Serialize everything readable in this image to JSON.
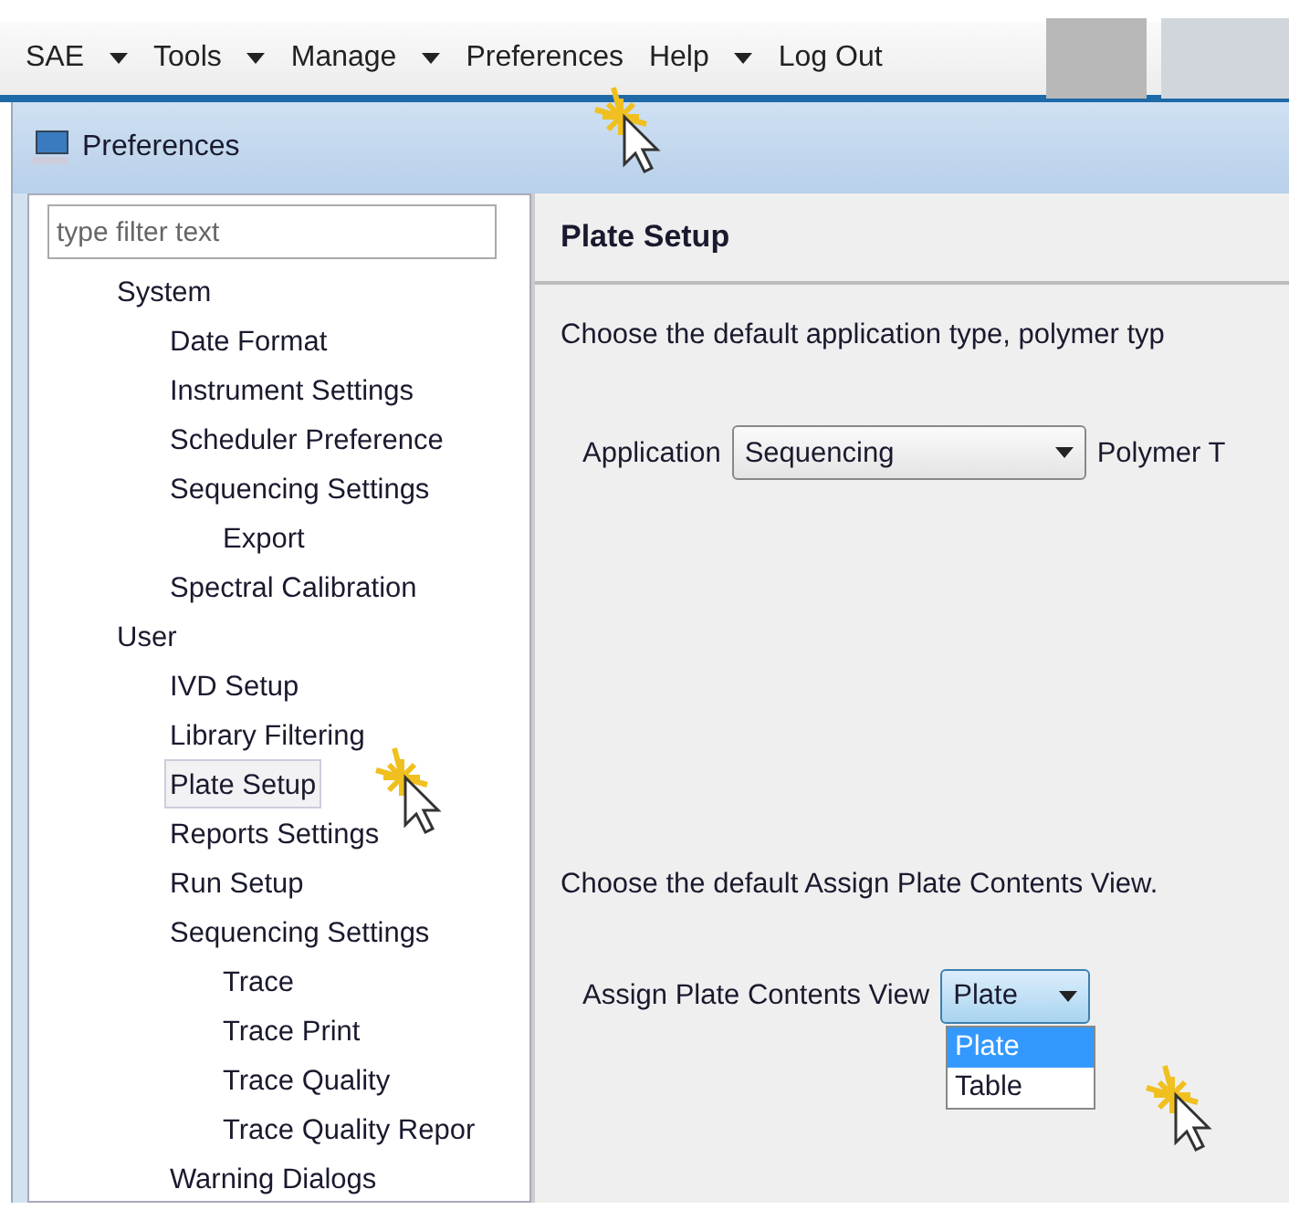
{
  "menu": [
    {
      "label": "SAE",
      "caret": true
    },
    {
      "label": "Tools",
      "caret": true
    },
    {
      "label": "Manage",
      "caret": true
    },
    {
      "label": "Preferences",
      "caret": false
    },
    {
      "label": "Help",
      "caret": true
    },
    {
      "label": "Log Out",
      "caret": false
    }
  ],
  "window": {
    "title": "Preferences"
  },
  "filter": {
    "placeholder": "type filter text"
  },
  "tree": [
    {
      "label": "System",
      "selected": false,
      "children": [
        {
          "label": "Date Format",
          "selected": false
        },
        {
          "label": "Instrument Settings",
          "selected": false
        },
        {
          "label": "Scheduler Preference",
          "selected": false
        },
        {
          "label": "Sequencing Settings",
          "selected": false,
          "children": [
            {
              "label": "Export",
              "selected": false
            }
          ]
        },
        {
          "label": "Spectral Calibration",
          "selected": false
        }
      ]
    },
    {
      "label": "User",
      "selected": false,
      "children": [
        {
          "label": "IVD Setup",
          "selected": false
        },
        {
          "label": "Library Filtering",
          "selected": false
        },
        {
          "label": "Plate Setup",
          "selected": true
        },
        {
          "label": "Reports Settings",
          "selected": false
        },
        {
          "label": "Run Setup",
          "selected": false
        },
        {
          "label": "Sequencing Settings",
          "selected": false,
          "children": [
            {
              "label": "Trace",
              "selected": false
            },
            {
              "label": "Trace Print",
              "selected": false
            },
            {
              "label": "Trace Quality",
              "selected": false
            },
            {
              "label": "Trace Quality Repor",
              "selected": false
            }
          ]
        },
        {
          "label": "Warning Dialogs",
          "selected": false
        }
      ]
    }
  ],
  "page": {
    "title": "Plate Setup",
    "description_1": "Choose the default application type, polymer typ",
    "application": {
      "label": "Application",
      "value": "Sequencing"
    },
    "polymer_label": "Polymer T",
    "description_2": "Choose the default Assign Plate Contents View.",
    "view": {
      "label": "Assign Plate Contents View",
      "value": "Plate",
      "expanded": true,
      "options": [
        {
          "label": "Plate",
          "selected": true
        },
        {
          "label": "Table",
          "selected": false
        }
      ]
    }
  }
}
